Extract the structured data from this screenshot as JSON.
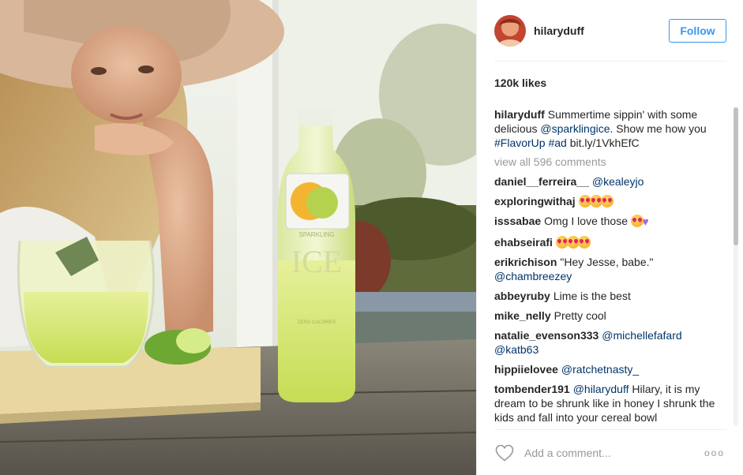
{
  "post": {
    "username": "hilaryduff",
    "follow_label": "Follow",
    "likes": "120k likes",
    "caption": {
      "user": "hilaryduff",
      "text_1": "Summertime sippin' with some delicious ",
      "mention": "@sparklingice",
      "text_2": ". Show me how you ",
      "hashtag_1": "#FlavorUp",
      "hashtag_2": "#ad",
      "link": "bit.ly/1VkhEfC"
    },
    "view_all": "view all 596 comments",
    "comments": [
      {
        "user": "daniel__ferreira__",
        "mention": "@kealeyjo",
        "text": ""
      },
      {
        "user": "exploringwithaj",
        "mention": "",
        "text": "",
        "emojis": 3
      },
      {
        "user": "isssabae",
        "mention": "",
        "text": "Omg I love those",
        "emojis": 1,
        "purple_heart": true
      },
      {
        "user": "ehabseirafi",
        "mention": "",
        "text": "",
        "emojis": 3
      },
      {
        "user": "erikrichison",
        "mention": "@chambreezey",
        "text": "\"Hey Jesse, babe.\""
      },
      {
        "user": "abbeyruby",
        "mention": "",
        "text": "Lime is the best"
      },
      {
        "user": "mike_nelly",
        "mention": "",
        "text": "Pretty cool"
      },
      {
        "user": "natalie_evenson333",
        "mention": "@michellefafard @katb63",
        "text": ""
      },
      {
        "user": "hippiielovee",
        "mention": "@ratchetnasty_",
        "text": ""
      },
      {
        "user": "tombender191",
        "mention": "@hilaryduff",
        "text": "Hilary, it is my dream to be shrunk like in honey I shrunk the kids and fall into your cereal bowl"
      }
    ],
    "add_comment_placeholder": "Add a comment...",
    "more_glyph": "ooo",
    "photo": {
      "bottle_brand": "SPARKLING",
      "bottle_name": "ICE",
      "bottle_sub": "ZERO CALORIES"
    },
    "colors": {
      "accent": "#3897f0",
      "link": "#003569",
      "muted": "#999999"
    },
    "icons": [
      "heart-icon",
      "more-options-icon"
    ]
  }
}
